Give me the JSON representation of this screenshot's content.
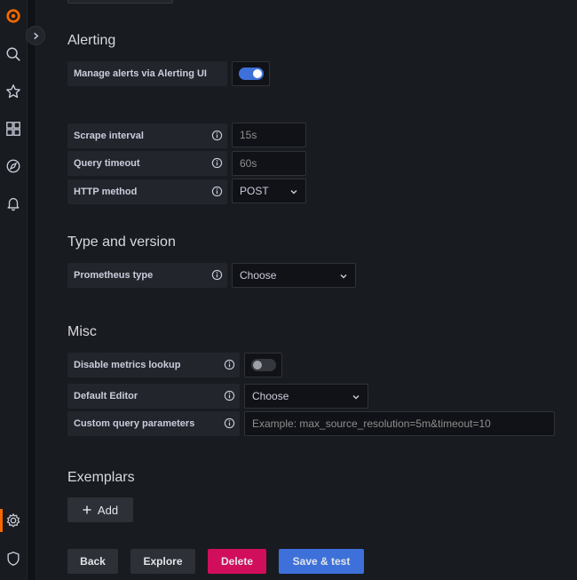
{
  "sidebar": {
    "icons": [
      "grafana-logo",
      "search-icon",
      "star-icon",
      "dashboards-icon",
      "explore-icon",
      "alerting-icon",
      "configuration-icon",
      "shield-icon"
    ]
  },
  "alerting": {
    "title": "Alerting",
    "manage_label": "Manage alerts via Alerting UI",
    "manage_enabled": true
  },
  "general": {
    "scrape_interval_label": "Scrape interval",
    "scrape_interval_placeholder": "15s",
    "query_timeout_label": "Query timeout",
    "query_timeout_placeholder": "60s",
    "http_method_label": "HTTP method",
    "http_method_value": "POST"
  },
  "type_version": {
    "title": "Type and version",
    "prometheus_type_label": "Prometheus type",
    "prometheus_type_value": "Choose"
  },
  "misc": {
    "title": "Misc",
    "disable_metrics_label": "Disable metrics lookup",
    "disable_metrics_enabled": false,
    "default_editor_label": "Default Editor",
    "default_editor_value": "Choose",
    "custom_params_label": "Custom query parameters",
    "custom_params_placeholder": "Example: max_source_resolution=5m&timeout=10"
  },
  "exemplars": {
    "title": "Exemplars",
    "add_label": "Add"
  },
  "actions": {
    "back": "Back",
    "explore": "Explore",
    "delete": "Delete",
    "save_test": "Save & test"
  },
  "colors": {
    "primary": "#3d71d9",
    "destructive": "#d10e5c",
    "secondary": "#2d3036",
    "logo": "#f46800"
  }
}
